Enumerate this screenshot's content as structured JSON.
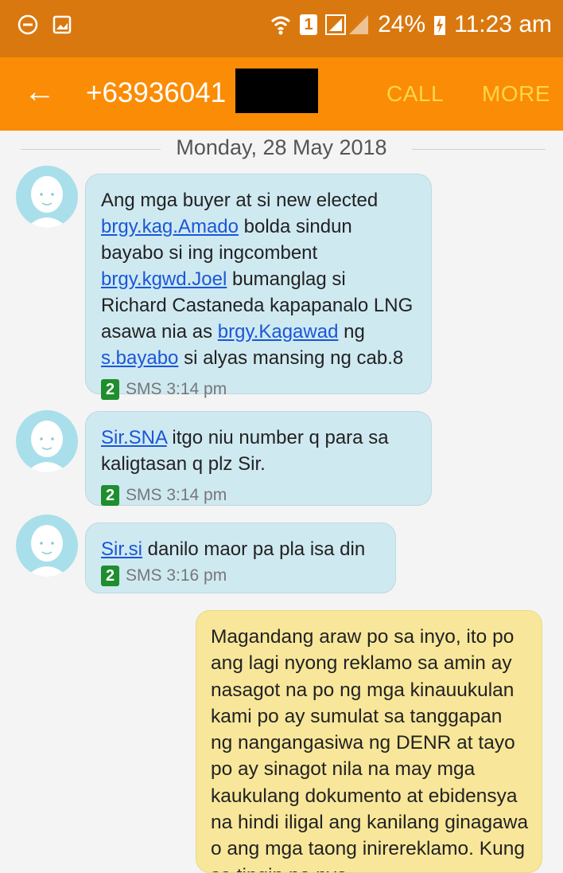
{
  "status_bar": {
    "battery": "24%",
    "time": "11:23 am",
    "sim_badge": "1",
    "icons": [
      "dnd-icon",
      "image-notification-icon",
      "wifi-icon",
      "sim-icon",
      "signal-icon",
      "charging-icon"
    ]
  },
  "app_bar": {
    "back_icon": "←",
    "contact": "+63936041",
    "call_label": "CALL",
    "more_label": "MORE"
  },
  "date_divider": "Monday, 28 May 2018",
  "messages": [
    {
      "direction": "incoming",
      "parts": [
        {
          "text": "Ang mga buyer at si new elected "
        },
        {
          "text": "brgy.kag.Amado",
          "link": true
        },
        {
          "text": " bolda sindun bayabo si ing ingcombent "
        },
        {
          "text": "brgy.kgwd.Joel",
          "link": true
        },
        {
          "text": " bumanglag si Richard Castaneda kapapanalo LNG asawa nia as "
        },
        {
          "text": "brgy.Kagawad",
          "link": true
        },
        {
          "text": " ng "
        },
        {
          "text": "s.bayabo",
          "link": true
        },
        {
          "text": " si alyas mansing ng cab.8"
        }
      ],
      "sim": "2",
      "meta": "SMS 3:14 pm"
    },
    {
      "direction": "incoming",
      "parts": [
        {
          "text": "Sir.SNA",
          "link": true
        },
        {
          "text": " itgo niu number q para sa kaligtasan q plz Sir."
        }
      ],
      "sim": "2",
      "meta": "SMS 3:14 pm"
    },
    {
      "direction": "incoming",
      "parts": [
        {
          "text": "Sir.si",
          "link": true
        },
        {
          "text": " danilo maor pa pla  isa din"
        }
      ],
      "sim": "2",
      "meta": "SMS 3:16 pm"
    },
    {
      "direction": "outgoing",
      "parts": [
        {
          "text": "Magandang araw po sa inyo, ito po ang lagi nyong reklamo sa amin ay nasagot na po ng mga kinauukulan kami po ay sumulat sa tanggapan ng nangangasiwa ng DENR at tayo po ay sinagot nila na may mga kaukulang dokumento at ebidensya na hindi iligal ang kanilang ginagawa o ang mga taong inirereklamo. Kung sa tingin po nyo"
        }
      ]
    }
  ],
  "colors": {
    "status_bar": "#d9780f",
    "app_bar": "#fb8c06",
    "action_text": "#ffd54a",
    "incoming_bubble": "#cfe9f1",
    "outgoing_bubble": "#f8e79a",
    "link": "#1a57d8",
    "sim_badge": "#1e8e2e"
  }
}
